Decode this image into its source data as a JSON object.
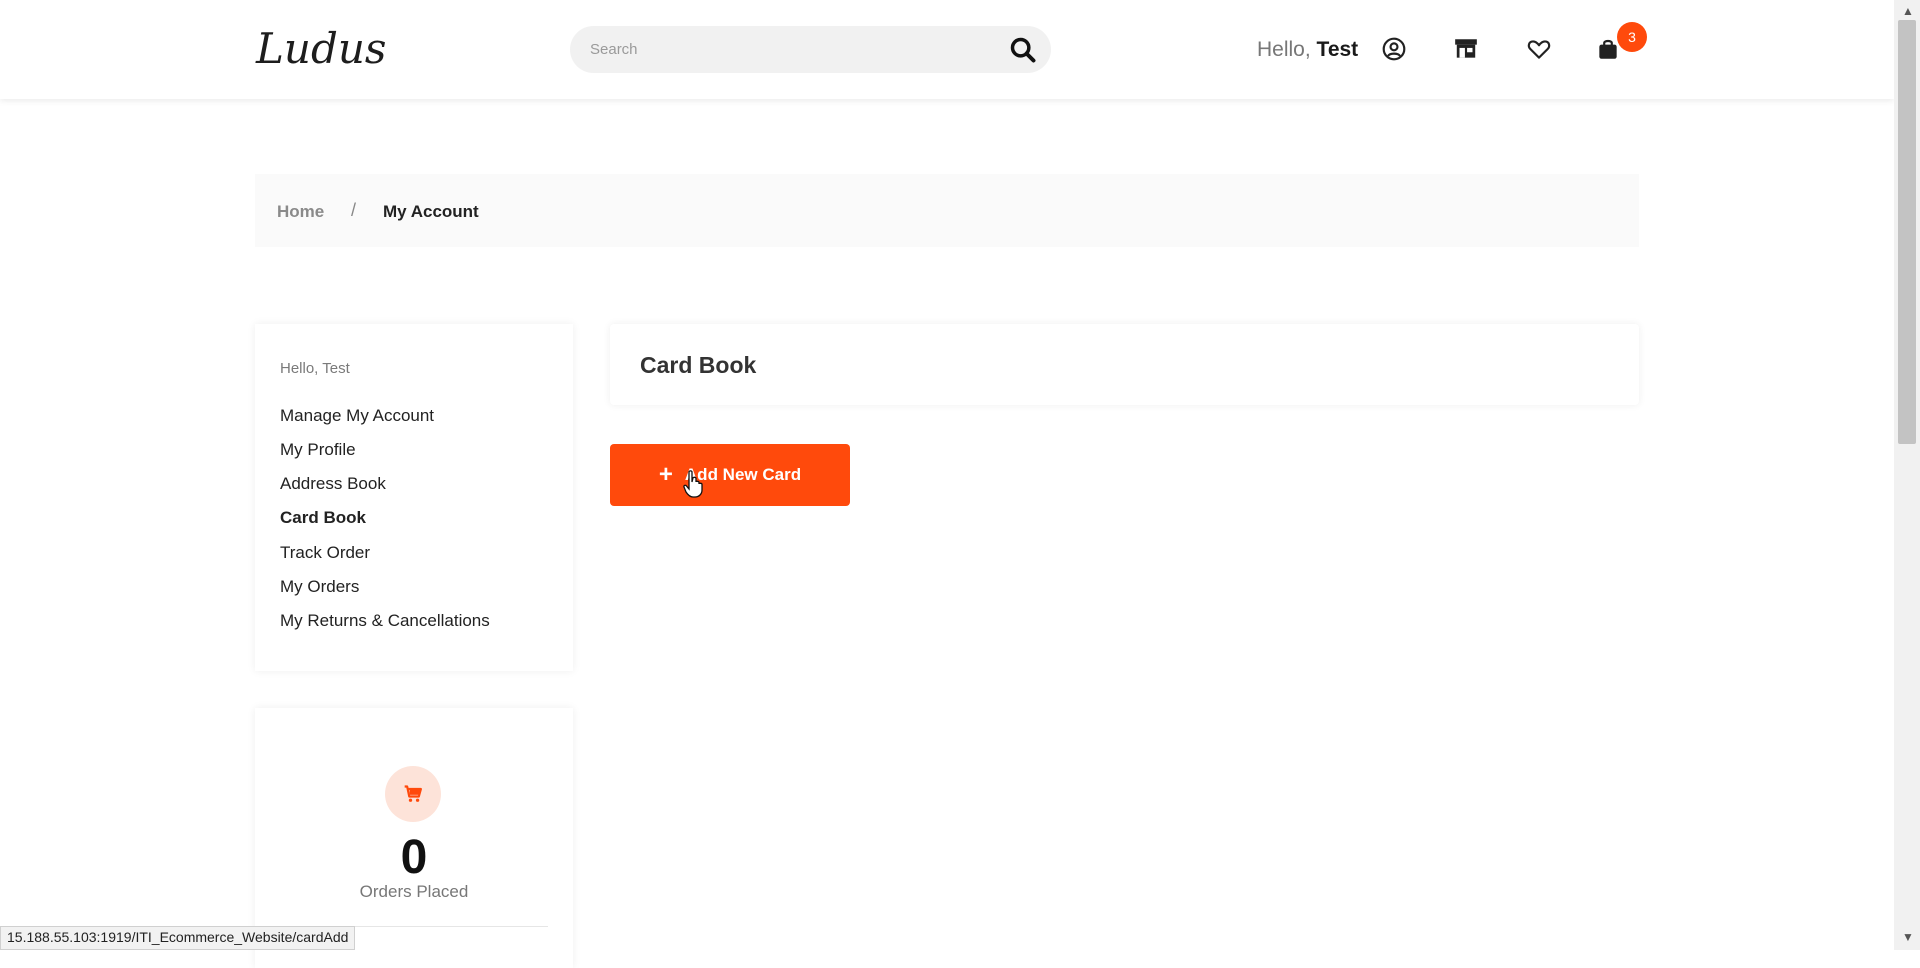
{
  "header": {
    "logo": "Ludus",
    "search_placeholder": "Search",
    "greeting_prefix": "Hello,",
    "greeting_name": "Test",
    "cart_count": "3"
  },
  "breadcrumb": {
    "home": "Home",
    "separator": "/",
    "current": "My Account"
  },
  "sidebar": {
    "hello": "Hello, Test",
    "items": [
      {
        "label": "Manage My Account"
      },
      {
        "label": "My Profile"
      },
      {
        "label": "Address Book"
      },
      {
        "label": "Card Book"
      },
      {
        "label": "Track Order"
      },
      {
        "label": "My Orders"
      },
      {
        "label": "My Returns & Cancellations"
      }
    ]
  },
  "stats": {
    "orders_value": "0",
    "orders_label": "Orders Placed"
  },
  "main": {
    "title": "Card Book",
    "add_button": "Add New Card"
  },
  "status_url": "15.188.55.103:1919/ITI_Ecommerce_Website/cardAdd",
  "colors": {
    "accent": "#ff4a0c",
    "accent_light": "#fde3d9"
  }
}
